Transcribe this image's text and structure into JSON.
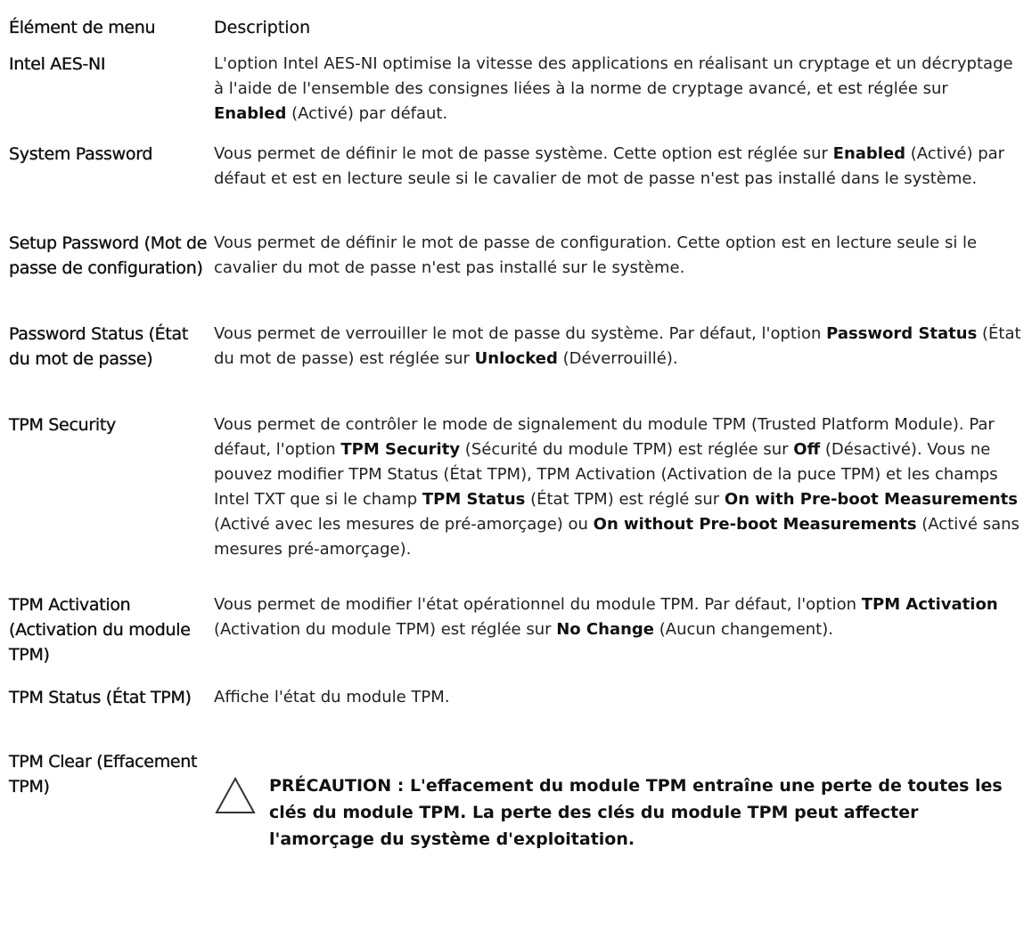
{
  "header": {
    "col1": "Élément de menu",
    "col2": "Description"
  },
  "rows": [
    {
      "name": "Intel AES-NI",
      "desc": [
        {
          "t": "L'option Intel AES-NI optimise la vitesse des applications en réalisant un cryptage et un décryptage à l'aide de l'ensemble des consignes liées à la norme de cryptage avancé, et est réglée sur ",
          "b": false
        },
        {
          "t": "Enabled",
          "b": true
        },
        {
          "t": " (Activé) par défaut.",
          "b": false
        }
      ]
    },
    {
      "name": "System Password",
      "desc": [
        {
          "t": "Vous permet de définir le mot de passe système. Cette option est réglée sur ",
          "b": false
        },
        {
          "t": "Enabled",
          "b": true
        },
        {
          "t": " (Activé) par défaut et est en lecture seule si le cavalier de mot de passe n'est pas installé dans le système.",
          "b": false
        }
      ]
    },
    {
      "name": "Setup Password (Mot de passe de configuration)",
      "desc": [
        {
          "t": "Vous permet de définir le mot de passe de configuration. Cette option est en lecture seule si le cavalier du mot de passe n'est pas installé sur le système.",
          "b": false
        }
      ]
    },
    {
      "name": "Password Status (État du mot de passe)",
      "desc": [
        {
          "t": "Vous permet de verrouiller le mot de passe du système. Par défaut, l'option ",
          "b": false
        },
        {
          "t": "Password Status",
          "b": true
        },
        {
          "t": " (État du mot de passe) est réglée sur ",
          "b": false
        },
        {
          "t": "Unlocked",
          "b": true
        },
        {
          "t": " (Déverrouillé).",
          "b": false
        }
      ]
    },
    {
      "name": "TPM Security",
      "desc": [
        {
          "t": "Vous permet de contrôler le mode de signalement du module TPM (Trusted Platform Module). Par défaut, l'option ",
          "b": false
        },
        {
          "t": "TPM Security",
          "b": true
        },
        {
          "t": " (Sécurité du module TPM) est réglée sur ",
          "b": false
        },
        {
          "t": "Off",
          "b": true
        },
        {
          "t": " (Désactivé). Vous ne pouvez modifier TPM Status (État TPM), TPM Activation (Activation de la puce TPM) et les champs Intel TXT que si le champ ",
          "b": false
        },
        {
          "t": "TPM Status",
          "b": true
        },
        {
          "t": " (État TPM) est réglé sur ",
          "b": false
        },
        {
          "t": "On with Pre-boot Measurements",
          "b": true
        },
        {
          "t": " (Activé avec les mesures de pré-amorçage) ou ",
          "b": false
        },
        {
          "t": "On without Pre-boot Measurements",
          "b": true
        },
        {
          "t": " (Activé sans mesures pré-amorçage).",
          "b": false
        }
      ]
    },
    {
      "name": "TPM Activation (Activation du module TPM)",
      "desc": [
        {
          "t": "Vous permet de modifier l'état opérationnel du module TPM. Par défaut, l'option ",
          "b": false
        },
        {
          "t": "TPM Activation",
          "b": true
        },
        {
          "t": " (Activation du module TPM) est réglée sur ",
          "b": false
        },
        {
          "t": "No Change",
          "b": true
        },
        {
          "t": " (Aucun changement).",
          "b": false
        }
      ]
    },
    {
      "name": "TPM Status (État TPM)",
      "desc": [
        {
          "t": "Affiche l'état du module TPM.",
          "b": false
        }
      ]
    },
    {
      "name": "TPM Clear (Effacement TPM)",
      "desc": [],
      "caution": "PRÉCAUTION : L'effacement du module TPM entraîne une perte de toutes les clés du module TPM. La perte des clés du module TPM peut affecter l'amorçage du système d'exploitation.",
      "caution_icon": "warning-triangle-icon"
    }
  ]
}
